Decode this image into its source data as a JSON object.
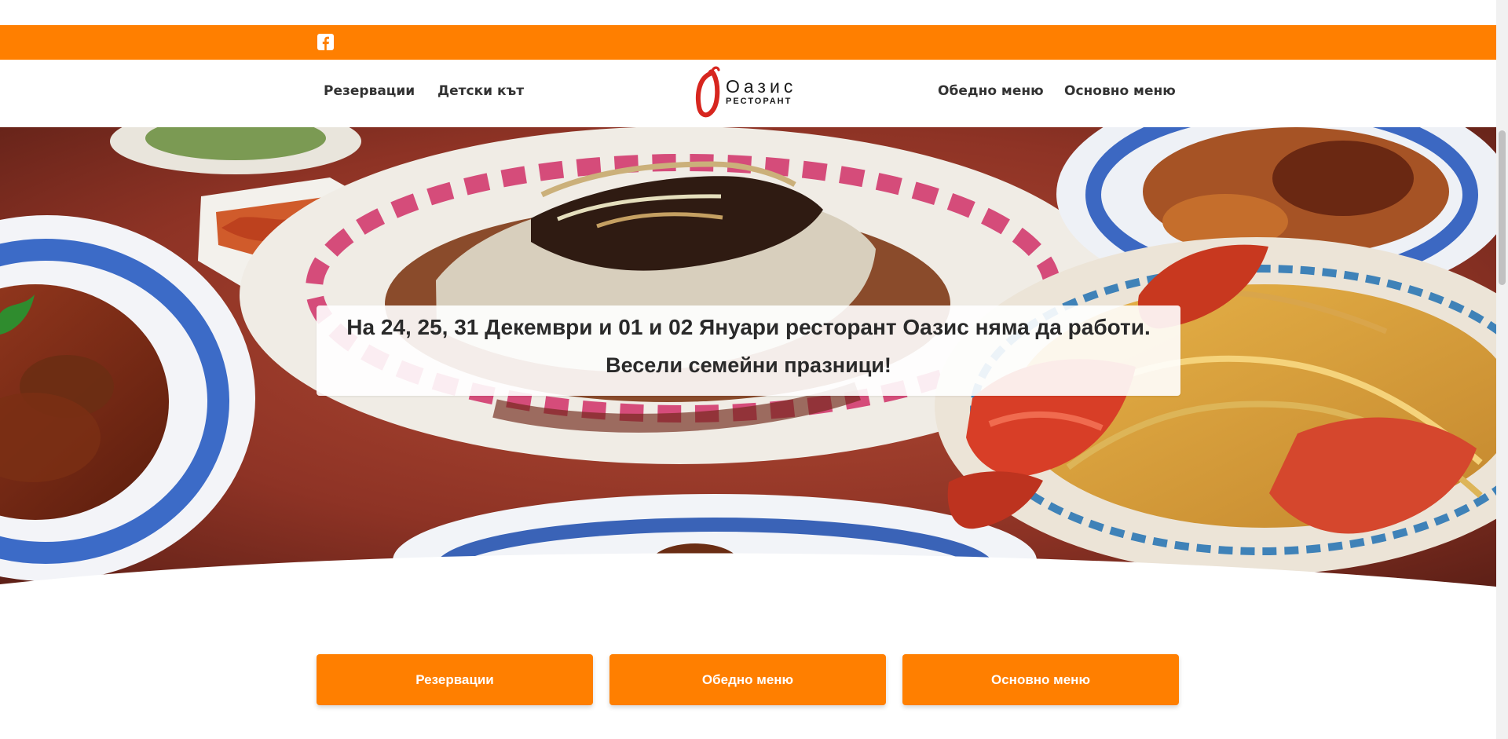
{
  "window_title": "Оазис ресторант",
  "top_bar": {
    "social_icon": "facebook-icon",
    "accent_color": "#ff7f00"
  },
  "header": {
    "nav_left": [
      "Резервации",
      "Детски кът"
    ],
    "nav_right": [
      "Обедно меню",
      "Основно меню"
    ],
    "logo": {
      "name": "Оазис",
      "sub": "РЕСТОРАНТ"
    }
  },
  "hero": {
    "notice_line_1": "На 24, 25, 31 Декември и 01 и 02 Януари ресторант Оазис няма да работи.",
    "notice_line_2": "Весели семейни празници!"
  },
  "cta_buttons": [
    "Резервации",
    "Обедно меню",
    "Основно меню"
  ]
}
